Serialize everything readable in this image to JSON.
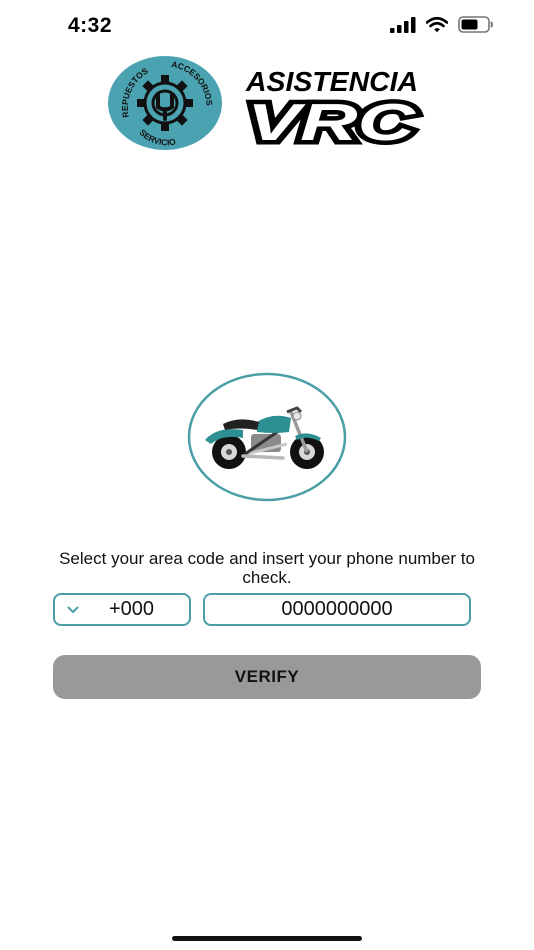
{
  "status_bar": {
    "time": "4:32",
    "icons": [
      "cellular-signal-icon",
      "wifi-icon",
      "battery-icon"
    ]
  },
  "logo": {
    "badge_words": [
      "REPUESTOS",
      "ACCESORIOS",
      "SERVICIO"
    ],
    "wordmark_top": "ASISTENCIA",
    "wordmark_bottom": "VRC",
    "badge_color": "#4ba3b1"
  },
  "hero": {
    "icon": "motorcycle-icon",
    "circle_color": "#4a9ea6"
  },
  "form": {
    "prompt": "Select your area code and insert your phone number to check.",
    "area_code_value": "+000",
    "phone_value": "0000000000",
    "verify_label": "VERIFY",
    "accent_color": "#4a9ea6",
    "button_color": "#999999"
  }
}
